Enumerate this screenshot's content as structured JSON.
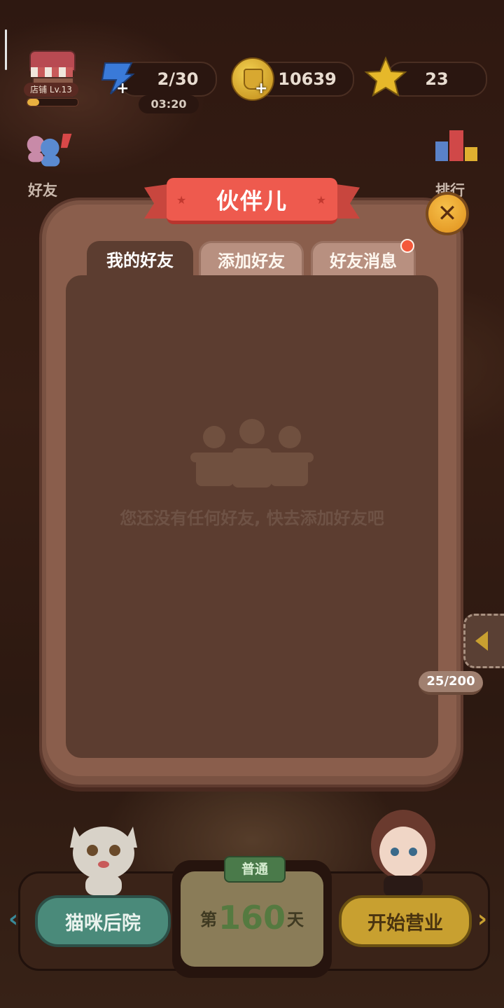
{
  "hud": {
    "shop_label": "店铺 Lv.13",
    "shop_progress": 0.24,
    "energy": "2/30",
    "energy_timer": "03:20",
    "coins": "10639",
    "stars": "23"
  },
  "side_menu": {
    "friends_label": "好友",
    "rank_label": "排行"
  },
  "dialog": {
    "title": "伙伴儿",
    "tabs": [
      {
        "label": "我的好友",
        "active": true
      },
      {
        "label": "添加好友",
        "active": false
      },
      {
        "label": "好友消息",
        "active": false,
        "has_badge": true
      }
    ],
    "empty_message": "您还没有任何好友, 快去添加好友吧",
    "friend_count": "25/200"
  },
  "bottom": {
    "left_button": "猫咪后院",
    "mode_tag": "普通",
    "day_prefix": "第",
    "day_number": "160",
    "day_suffix": "天",
    "right_button": "开始营业"
  },
  "icons": {
    "close": "close-icon",
    "friends": "friends-icon",
    "empty": "group-icon"
  },
  "colors": {
    "accent_red": "#ee5a4e",
    "close_orange": "#f0a830",
    "panel_brown": "#5c3d30"
  }
}
